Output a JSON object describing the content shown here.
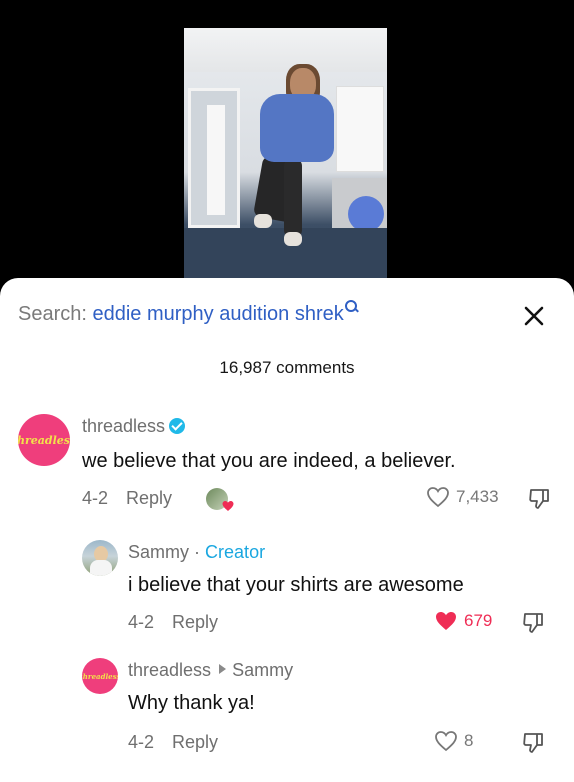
{
  "search": {
    "prefix": "Search: ",
    "query": "eddie murphy audition shrek"
  },
  "comments_count": "16,987 comments",
  "comments": [
    {
      "username": "threadless",
      "avatar_text": "threadless",
      "verified": true,
      "text": "we believe that you are indeed, a believer.",
      "date": "4-2",
      "reply_label": "Reply",
      "likes": "7,433",
      "liked": false
    },
    {
      "username": "Sammy",
      "badge": "Creator",
      "separator": "·",
      "text": "i believe that your shirts are awesome",
      "date": "4-2",
      "reply_label": "Reply",
      "likes": "679",
      "liked": true
    },
    {
      "username": "threadless",
      "avatar_text": "threadless",
      "reply_to": "Sammy",
      "text": "Why thank ya!",
      "date": "4-2",
      "reply_label": "Reply",
      "likes": "8",
      "liked": false
    }
  ],
  "colors": {
    "accent_blue": "#2f5fc4",
    "like_red": "#ef2d55",
    "creator_blue": "#1aa7e0",
    "brand_pink": "#ef3e7c"
  }
}
